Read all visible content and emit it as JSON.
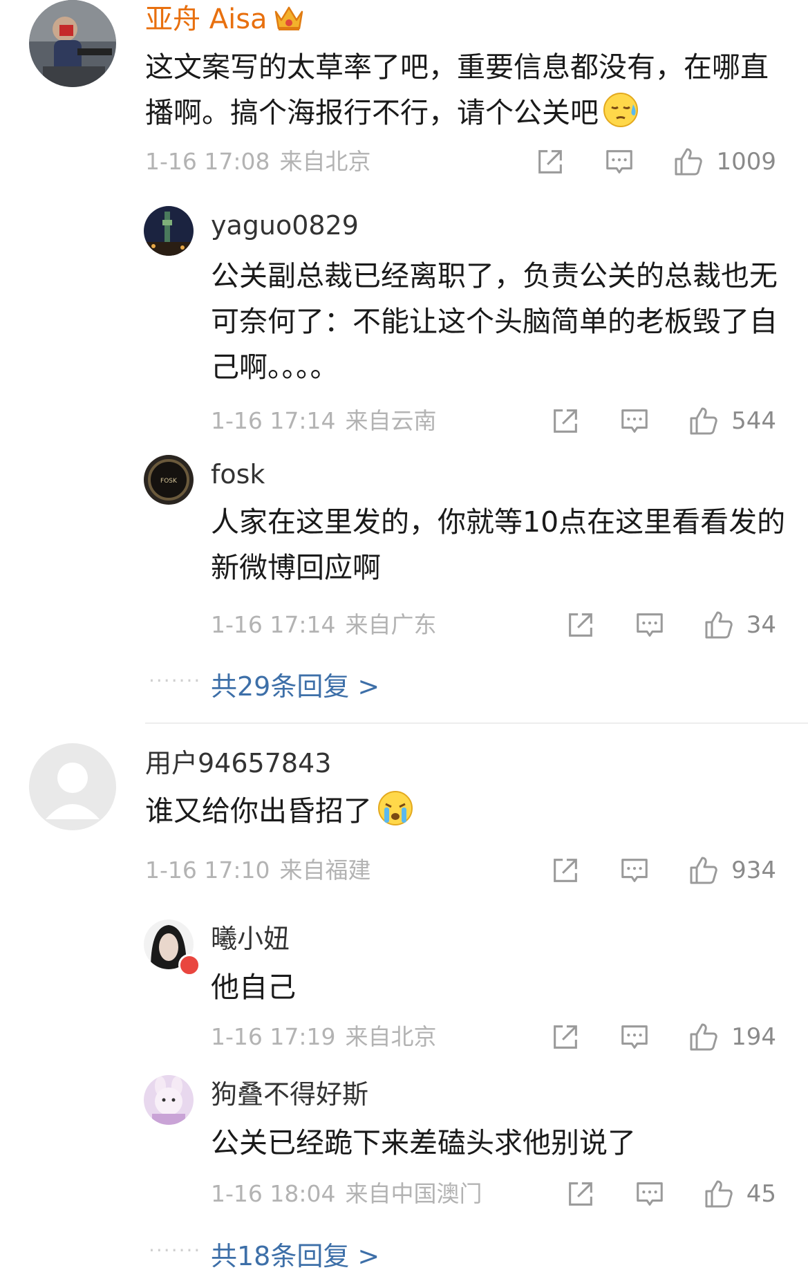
{
  "threads": [
    {
      "author": "亚舟 Aisa",
      "text": "这文案写的太草率了吧，重要信息都没有，在哪直播啊。搞个海报行不行，请个公关吧",
      "time": "1-16 17:08",
      "location": "来自北京",
      "likes": "1009",
      "replies": [
        {
          "author": "yaguo0829",
          "text": "公关副总裁已经离职了，负责公关的总裁也无可奈何了：不能让这个头脑简单的老板毁了自己啊。。。。",
          "time": "1-16 17:14",
          "location": "来自云南",
          "likes": "544"
        },
        {
          "author": "fosk",
          "text": "人家在这里发的，你就等10点在这里看看发的新微博回应啊",
          "time": "1-16 17:14",
          "location": "来自广东",
          "likes": "34"
        }
      ],
      "more_replies": "共29条回复 >"
    },
    {
      "author": "用户94657843",
      "text": "谁又给你出昏招了",
      "time": "1-16 17:10",
      "location": "来自福建",
      "likes": "934",
      "replies": [
        {
          "author": "曦小妞",
          "text": "他自己",
          "time": "1-16 17:19",
          "location": "来自北京",
          "likes": "194"
        },
        {
          "author": "狗叠不得好斯",
          "text": "公关已经跪下来差磕头求他别说了",
          "time": "1-16 18:04",
          "location": "来自中国澳门",
          "likes": "45"
        }
      ],
      "more_replies": "共18条回复 >"
    }
  ],
  "icons": [
    "share-icon",
    "comment-icon",
    "thumbs-up-icon",
    "crown-icon",
    "sweat-emoji",
    "crying-emoji"
  ],
  "colors": {
    "vip_name": "#e8700f",
    "link": "#3d6fa8",
    "meta": "#b3b3b3"
  }
}
